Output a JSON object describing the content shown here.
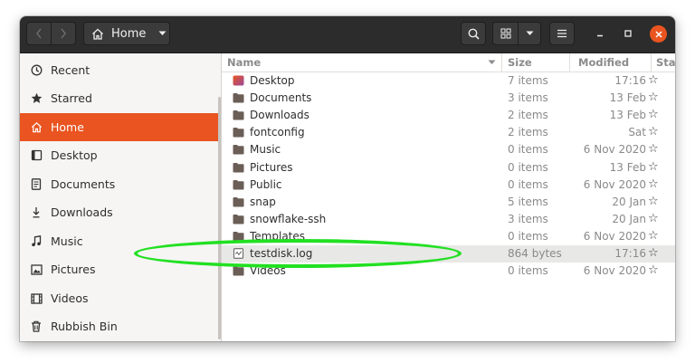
{
  "headerbar": {
    "path_label": "Home",
    "icons": {
      "back": "chevron-left-icon",
      "forward": "chevron-right-icon",
      "home": "home-icon",
      "path_dropdown": "caret-down-icon",
      "search": "search-icon",
      "view": "grid-view-icon",
      "view_dropdown": "caret-down-icon",
      "menu": "hamburger-menu-icon",
      "minimize": "minimize-icon",
      "maximize": "maximize-icon",
      "close": "close-icon"
    }
  },
  "sidebar": {
    "items": [
      {
        "label": "Recent",
        "icon": "clock-icon"
      },
      {
        "label": "Starred",
        "icon": "star-filled-icon"
      },
      {
        "label": "Home",
        "icon": "home-icon",
        "active": true
      },
      {
        "label": "Desktop",
        "icon": "desktop-icon"
      },
      {
        "label": "Documents",
        "icon": "document-icon"
      },
      {
        "label": "Downloads",
        "icon": "download-icon"
      },
      {
        "label": "Music",
        "icon": "music-note-icon"
      },
      {
        "label": "Pictures",
        "icon": "picture-icon"
      },
      {
        "label": "Videos",
        "icon": "film-icon"
      },
      {
        "label": "Rubbish Bin",
        "icon": "trash-icon"
      }
    ]
  },
  "list": {
    "columns": {
      "name": "Name",
      "size": "Size",
      "modified": "Modified",
      "star": "Star"
    },
    "rows": [
      {
        "name": "Desktop",
        "size": "7 items",
        "modified": "17:16",
        "type": "desktop-folder"
      },
      {
        "name": "Documents",
        "size": "3 items",
        "modified": "13 Feb",
        "type": "folder"
      },
      {
        "name": "Downloads",
        "size": "2 items",
        "modified": "13 Feb",
        "type": "folder"
      },
      {
        "name": "fontconfig",
        "size": "2 items",
        "modified": "Sat",
        "type": "folder"
      },
      {
        "name": "Music",
        "size": "0 items",
        "modified": "6 Nov 2020",
        "type": "folder"
      },
      {
        "name": "Pictures",
        "size": "0 items",
        "modified": "13 Feb",
        "type": "folder"
      },
      {
        "name": "Public",
        "size": "0 items",
        "modified": "6 Nov 2020",
        "type": "folder"
      },
      {
        "name": "snap",
        "size": "5 items",
        "modified": "20 Jan",
        "type": "folder"
      },
      {
        "name": "snowflake-ssh",
        "size": "3 items",
        "modified": "20 Jan",
        "type": "folder"
      },
      {
        "name": "Templates",
        "size": "0 items",
        "modified": "6 Nov 2020",
        "type": "folder"
      },
      {
        "name": "testdisk.log",
        "size": "864 bytes",
        "modified": "17:16",
        "type": "file",
        "selected": true
      },
      {
        "name": "Videos",
        "size": "0 items",
        "modified": "6 Nov 2020",
        "type": "folder"
      }
    ],
    "star_glyph": "☆"
  },
  "colors": {
    "accent": "#e95420",
    "headerbar": "#2c2c2c",
    "folder": "#6b5e57",
    "annotation": "#22e022"
  }
}
